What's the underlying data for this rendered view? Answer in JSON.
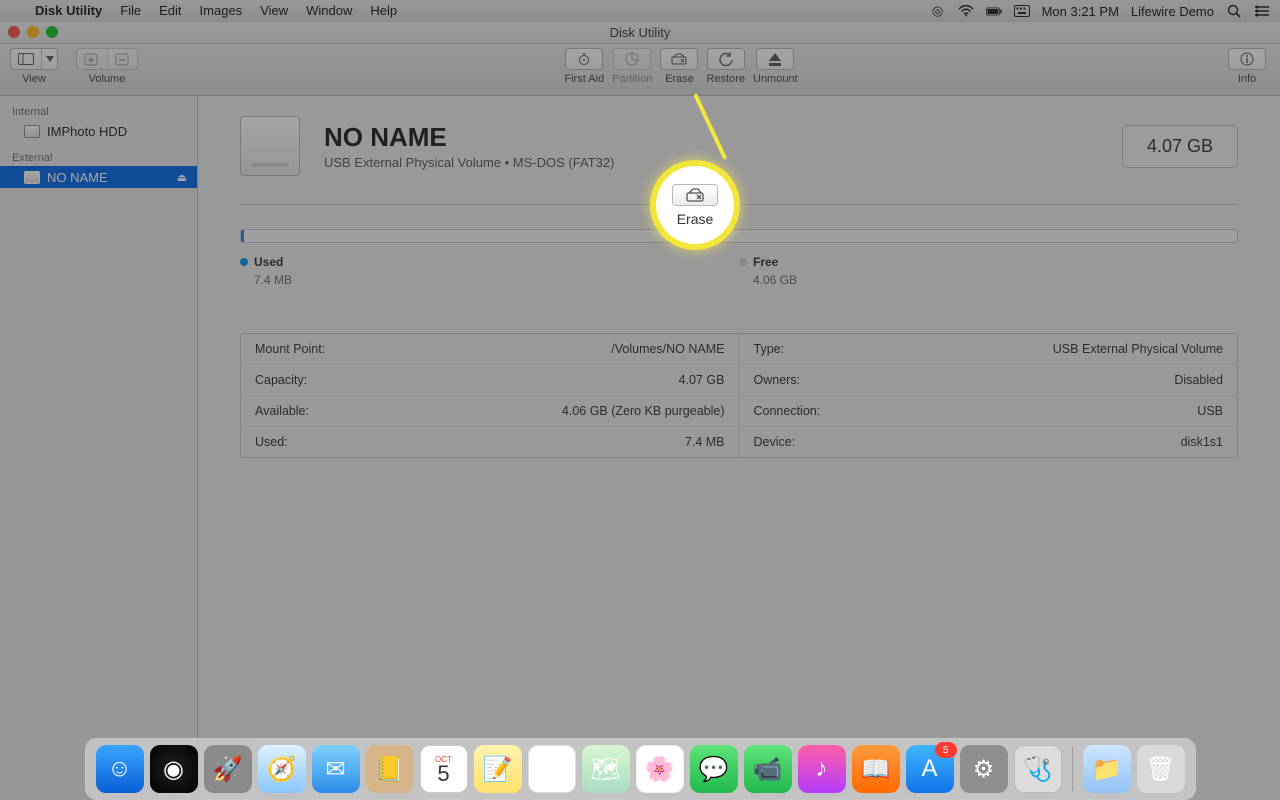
{
  "menubar": {
    "app": "Disk Utility",
    "items": [
      "File",
      "Edit",
      "Images",
      "View",
      "Window",
      "Help"
    ],
    "clock": "Mon 3:21 PM",
    "user": "Lifewire Demo"
  },
  "window": {
    "title": "Disk Utility",
    "toolbar": {
      "view_label": "View",
      "volume_label": "Volume",
      "firstaid": "First Aid",
      "partition": "Partition",
      "erase": "Erase",
      "restore": "Restore",
      "unmount": "Unmount",
      "info": "Info"
    }
  },
  "sidebar": {
    "internal_header": "Internal",
    "internal_items": [
      {
        "label": "IMPhoto HDD"
      }
    ],
    "external_header": "External",
    "external_items": [
      {
        "label": "NO NAME"
      }
    ]
  },
  "volume": {
    "name": "NO NAME",
    "subtitle": "USB External Physical Volume • MS-DOS (FAT32)",
    "size": "4.07 GB"
  },
  "usage": {
    "used_label": "Used",
    "used_value": "7.4 MB",
    "free_label": "Free",
    "free_value": "4.06 GB"
  },
  "info": {
    "left": [
      {
        "k": "Mount Point:",
        "v": "/Volumes/NO NAME"
      },
      {
        "k": "Capacity:",
        "v": "4.07 GB"
      },
      {
        "k": "Available:",
        "v": "4.06 GB (Zero KB purgeable)"
      },
      {
        "k": "Used:",
        "v": "7.4 MB"
      }
    ],
    "right": [
      {
        "k": "Type:",
        "v": "USB External Physical Volume"
      },
      {
        "k": "Owners:",
        "v": "Disabled"
      },
      {
        "k": "Connection:",
        "v": "USB"
      },
      {
        "k": "Device:",
        "v": "disk1s1"
      }
    ]
  },
  "callout": {
    "label": "Erase"
  },
  "dock": {
    "badge_appstore": "5",
    "cal_day": "5",
    "cal_month": "OCT"
  }
}
